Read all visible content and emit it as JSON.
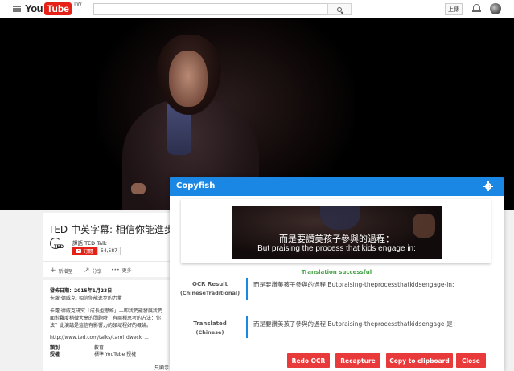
{
  "header": {
    "logo_you": "You",
    "logo_tube": "Tube",
    "logo_region": "TW",
    "search_placeholder": "",
    "upload_label": "上傳",
    "icons": [
      "menu-icon",
      "search-icon",
      "bell-icon"
    ]
  },
  "video": {
    "title": "TED 中英字幕: 相信你能進步",
    "channel": "譯語 TED Talk",
    "subscribe_label": "訂閱",
    "subscriber_count": "54,587",
    "actions": [
      {
        "icon": "+",
        "label": "新增至"
      },
      {
        "icon": "↗",
        "label": "分享"
      },
      {
        "icon": "•••",
        "label": "更多"
      }
    ]
  },
  "description": {
    "published": "發佈日期：2015年1月23日",
    "line1": "卡蘿·德威克: 相信你能進步的力量",
    "line2": "卡蘿·德威克研究「成長型思維」—即我們能發展我們",
    "line3": "面對難度稍微大高的問題時，有兩種思考的方法：你",
    "line4": "法？此演講是這信有影響力的領域程好的概論。",
    "link": "http://www.ted.com/talks/carol_dweck_...",
    "category_label": "類別",
    "category_value": "教育",
    "license_label": "授權",
    "license_value": "標準 YouTube 授權",
    "show_more": "只顯示"
  },
  "copyfish": {
    "title": "Copyfish",
    "subtitle_zh": "而是要讚美孩子參與的過程：",
    "subtitle_en": "But praising the process that kids engage in:",
    "status": "Translation successful",
    "ocr_label": "OCR Result",
    "ocr_lang": "(ChineseTraditional)",
    "ocr_text": "而是要讚美孩子參與的過程 Butpraising-theprocessthatkidsengage-in:",
    "translated_label": "Translated",
    "translated_lang": "(Chinese)",
    "translated_text": "而是要讚美孩子參與的過程 Butpraising-theprocessthatkidsengage-是：",
    "buttons": {
      "redo": "Redo OCR",
      "recapture": "Recapture",
      "copy": "Copy to clipboard",
      "close": "Close"
    },
    "accent_color": "#1a87e5",
    "button_color": "#e8393b",
    "success_color": "#47a447"
  }
}
